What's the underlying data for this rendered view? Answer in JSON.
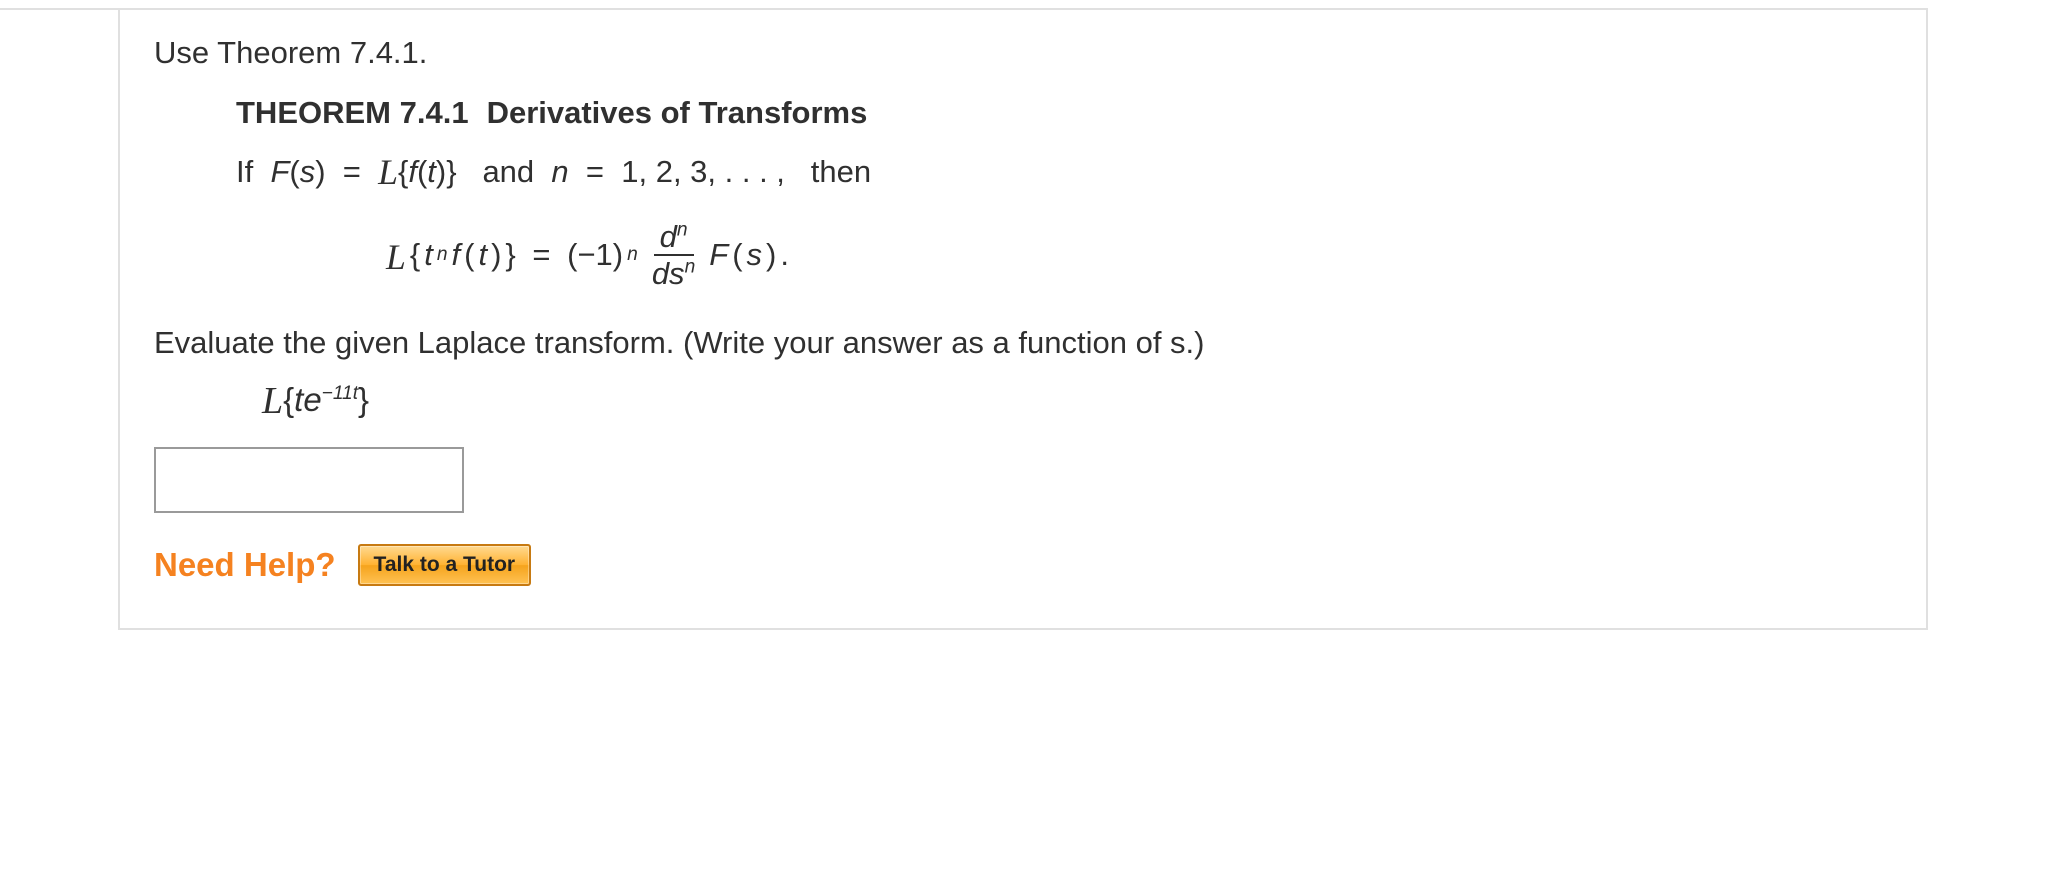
{
  "instruction": "Use Theorem 7.4.1.",
  "theorem": {
    "number_label": "THEOREM 7.4.1",
    "title": "Derivatives of Transforms",
    "cond_if": "If",
    "cond_fs": "F",
    "cond_fs_arg": "s",
    "cond_eq": "=",
    "cond_lap_open": "{",
    "cond_lap_f": "f",
    "cond_lap_arg": "t",
    "cond_lap_close": "}",
    "cond_and": "and",
    "cond_nvar": "n",
    "cond_nvals": "1, 2, 3, . . . ,",
    "cond_then": "then",
    "formula": {
      "lhs_t": "t",
      "lhs_n": "n",
      "lhs_f": "f",
      "lhs_arg": "t",
      "eq": "=",
      "neg1": "(−1)",
      "exp_n": "n",
      "frac_num_d": "d",
      "frac_num_n": "n",
      "frac_den_ds": "ds",
      "frac_den_n": "n",
      "rhs_F": "F",
      "rhs_arg": "s",
      "period": "."
    }
  },
  "evaluate_prompt": "Evaluate the given Laplace transform. (Write your answer as a function of s.)",
  "expression": {
    "open": "{",
    "t": "t",
    "e": "e",
    "exp_coeff": "−11",
    "exp_var": "t",
    "close": "}"
  },
  "answer_value": "",
  "need_help_label": "Need Help?",
  "tutor_button_label": "Talk to a Tutor"
}
